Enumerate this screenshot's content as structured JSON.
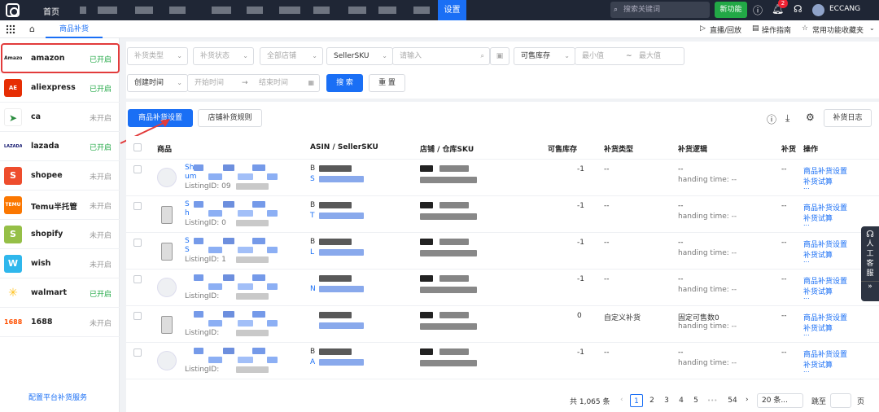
{
  "topbar": {
    "home": "首页",
    "active_tab": "设置",
    "search_placeholder": "搜索关键词",
    "new_func": "新功能",
    "badge_count": "2",
    "username": "ECCANG"
  },
  "tabbar": {
    "active_tab": "商品补货",
    "live": "直播/回放",
    "guide": "操作指南",
    "favorites": "常用功能收藏夹"
  },
  "platforms": [
    {
      "name": "amazon",
      "logo": "Amazon",
      "status": "已开启",
      "on": true,
      "color": "#ffffff"
    },
    {
      "name": "aliexpress",
      "logo": "AE",
      "status": "已开启",
      "on": true,
      "color": "#e62e04"
    },
    {
      "name": "ca",
      "logo": "ca",
      "status": "未开启",
      "on": false,
      "color": "#ffffff"
    },
    {
      "name": "lazada",
      "logo": "LAZADA",
      "status": "已开启",
      "on": true,
      "color": "#ffffff"
    },
    {
      "name": "shopee",
      "logo": "S",
      "status": "未开启",
      "on": false,
      "color": "#ee4d2d"
    },
    {
      "name": "Temu半托管",
      "logo": "TEMU",
      "status": "未开启",
      "on": false,
      "color": "#fb7701"
    },
    {
      "name": "shopify",
      "logo": "S",
      "status": "未开启",
      "on": false,
      "color": "#95bf47"
    },
    {
      "name": "wish",
      "logo": "W",
      "status": "未开启",
      "on": false,
      "color": "#2fb7ec"
    },
    {
      "name": "walmart",
      "logo": "✳",
      "status": "已开启",
      "on": true,
      "color": "#ffc220"
    },
    {
      "name": "1688",
      "logo": "1688",
      "status": "未开启",
      "on": false,
      "color": "#ffffff"
    }
  ],
  "sidebar_footer": "配置平台补货服务",
  "filters": {
    "type": "补货类型",
    "status": "补货状态",
    "store": "全部店铺",
    "sku_type": "SellerSKU",
    "sku_placeholder": "请输入",
    "stock": "可售库存",
    "min": "最小值",
    "tilde": "~",
    "max": "最大值",
    "time_type": "创建时间",
    "start": "开始时间",
    "arrow": "→",
    "end": "结束时间",
    "search": "搜 索",
    "reset": "重 置"
  },
  "toolbar": {
    "settings": "商品补货设置",
    "rules": "店铺补货规则",
    "log": "补货日志"
  },
  "columns": {
    "product": "商品",
    "asin": "ASIN / SellerSKU",
    "store": "店铺 / 仓库SKU",
    "stock": "可售库存",
    "type": "补货类型",
    "logic": "补货逻辑",
    "trunc": "补货",
    "ops": "操作"
  },
  "rows": [
    {
      "title": "Sh",
      "title2": "um",
      "listing": "ListingID: 09",
      "asin": "B",
      "sku": "S",
      "stock": "-1",
      "type": "--",
      "logic": "--",
      "logic2": "handing time: --",
      "trunc": "--",
      "op1": "商品补货设置",
      "op2": "补货试算",
      "op3": "...",
      "photo": false
    },
    {
      "title": "S",
      "title2": "h",
      "listing": "ListingID: 0",
      "asin": "B",
      "sku": "T",
      "stock": "-1",
      "type": "--",
      "logic": "--",
      "logic2": "handing time: --",
      "trunc": "--",
      "op1": "商品补货设置",
      "op2": "补货试算",
      "op3": "...",
      "photo": true
    },
    {
      "title": "S",
      "title2": "S",
      "listing": "ListingID: 1",
      "asin": "B",
      "sku": "L",
      "stock": "-1",
      "type": "--",
      "logic": "--",
      "logic2": "handing time: --",
      "trunc": "--",
      "op1": "商品补货设置",
      "op2": "补货试算",
      "op3": "...",
      "photo": true
    },
    {
      "title": "",
      "title2": "",
      "listing": "ListingID:",
      "asin": "",
      "sku": "N",
      "stock": "-1",
      "type": "--",
      "logic": "--",
      "logic2": "handing time: --",
      "trunc": "--",
      "op1": "商品补货设置",
      "op2": "补货试算",
      "op3": "...",
      "photo": false
    },
    {
      "title": "",
      "title2": "",
      "listing": "ListingID:",
      "asin": "",
      "sku": "",
      "stock": "0",
      "type": "自定义补货",
      "logic": "固定可售数0",
      "logic2": "handing time: --",
      "trunc": "--",
      "op1": "商品补货设置",
      "op2": "补货试算",
      "op3": "...",
      "photo": true
    },
    {
      "title": "",
      "title2": "",
      "listing": "ListingID:",
      "asin": "B",
      "sku": "A",
      "stock": "-1",
      "type": "--",
      "logic": "--",
      "logic2": "handing time: --",
      "trunc": "--",
      "op1": "商品补货设置",
      "op2": "补货试算",
      "op3": "...",
      "photo": false
    }
  ],
  "pagination": {
    "total": "共 1,065 条",
    "prev": "‹",
    "pages": [
      "1",
      "2",
      "3",
      "4",
      "5"
    ],
    "ellipsis": "•••",
    "last": "54",
    "next": "›",
    "page_size": "20 条...",
    "goto": "跳至",
    "page_unit": "页"
  },
  "float_cs": {
    "label": "人工客服",
    "more": "»"
  },
  "colors": {
    "primary": "#1a6ff5",
    "success": "#22a846",
    "highlight": "#e23b3b",
    "topbar": "#1f2635"
  }
}
